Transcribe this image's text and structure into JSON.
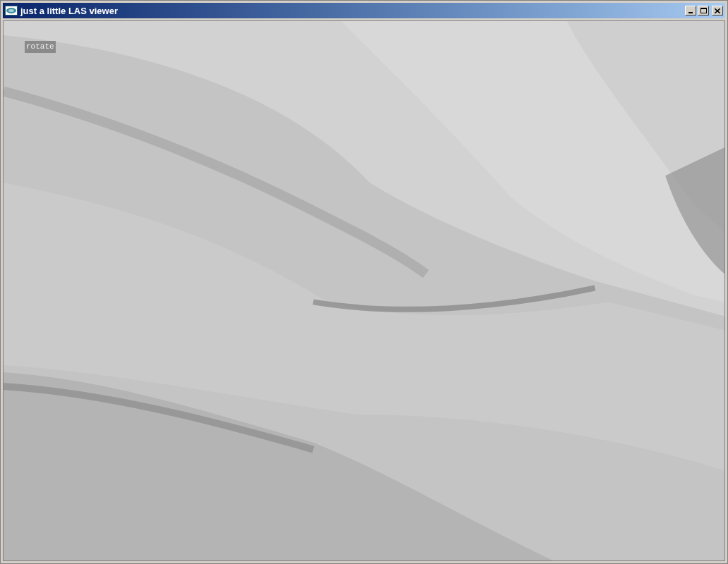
{
  "window": {
    "title": "just a little LAS viewer"
  },
  "viewport": {
    "mode_label": "rotate"
  }
}
